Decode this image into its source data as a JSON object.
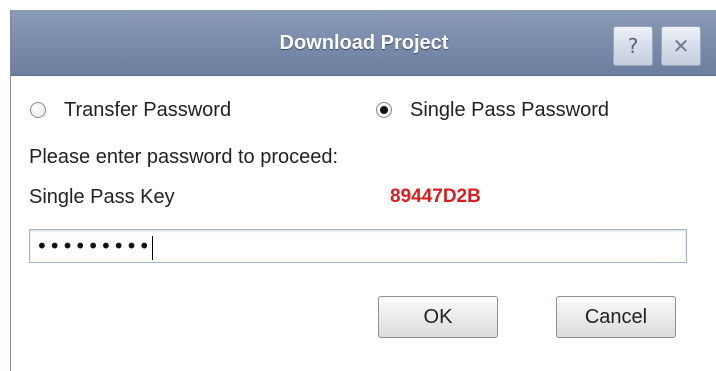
{
  "dialog": {
    "title": "Download Project",
    "help_glyph": "?",
    "close_glyph": "✕"
  },
  "options": {
    "transfer_label": "Transfer Password",
    "single_pass_label": "Single Pass Password",
    "selected": "single_pass"
  },
  "prompt": "Please enter password to proceed:",
  "key": {
    "label": "Single Pass Key",
    "value": "89447D2B",
    "value_color": "#d81e1e"
  },
  "password": {
    "masked_value": "•••••••••"
  },
  "buttons": {
    "ok": "OK",
    "cancel": "Cancel"
  }
}
